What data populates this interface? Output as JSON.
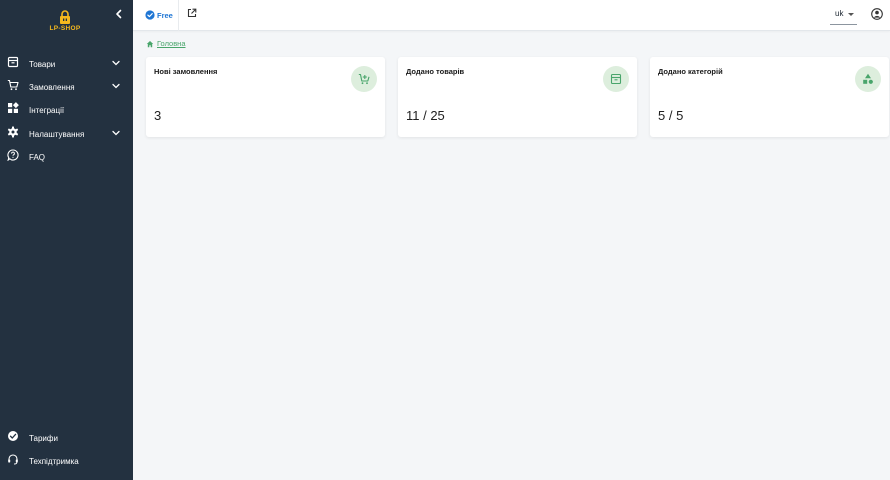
{
  "sidebar": {
    "logo_text": "LP-SHOP",
    "items": [
      {
        "label": "Товари",
        "icon": "archive-box-icon",
        "has_submenu": true
      },
      {
        "label": "Замовлення",
        "icon": "shopping-cart-icon",
        "has_submenu": true
      },
      {
        "label": "Інтеграції",
        "icon": "widgets-icon",
        "has_submenu": false
      },
      {
        "label": "Налаштування",
        "icon": "gear-icon",
        "has_submenu": true
      },
      {
        "label": "FAQ",
        "icon": "help-bubble-icon",
        "has_submenu": false
      }
    ],
    "bottom_items": [
      {
        "label": "Тарифи",
        "icon": "check-circle-icon"
      },
      {
        "label": "Техпідтримка",
        "icon": "headset-icon"
      }
    ]
  },
  "topbar": {
    "plan_label": "Free",
    "language": "uk"
  },
  "breadcrumb": {
    "home_label": "Головна"
  },
  "cards": [
    {
      "title": "Нові замовлення",
      "value": "3",
      "icon": "cart-plus-icon"
    },
    {
      "title": "Додано товарів",
      "value": "11 / 25",
      "icon": "archive-box-icon"
    },
    {
      "title": "Додано категорій",
      "value": "5 / 5",
      "icon": "shapes-icon"
    }
  ],
  "colors": {
    "sidebar_bg": "#233140",
    "accent_green": "#49a56b",
    "plan_blue": "#1f76d4",
    "logo_yellow": "#f6b91d"
  }
}
